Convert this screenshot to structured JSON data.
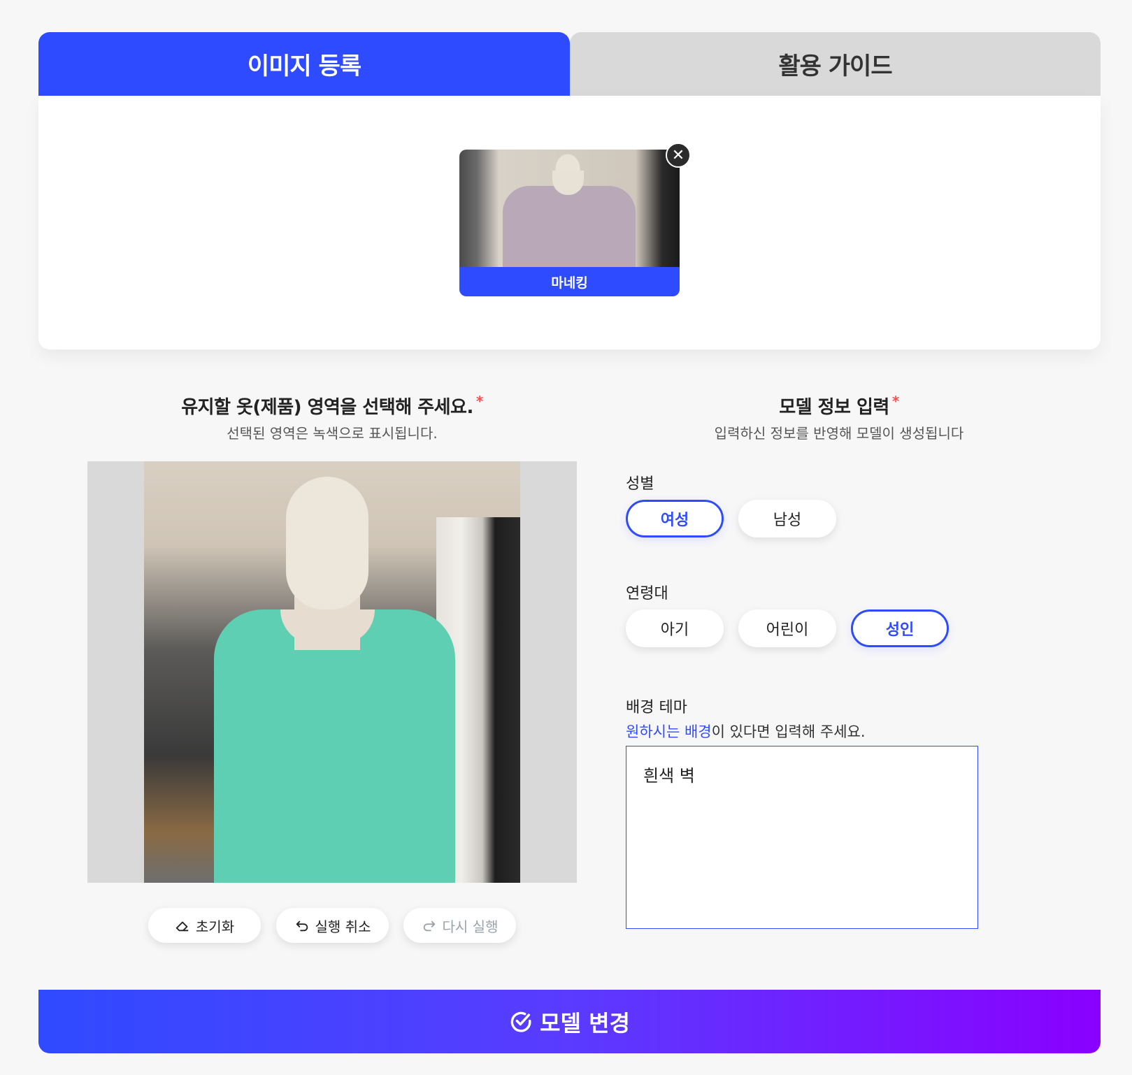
{
  "tabs": [
    {
      "label": "이미지 등록",
      "active": true
    },
    {
      "label": "활용 가이드",
      "active": false
    }
  ],
  "upload": {
    "thumbnail_label": "마네킹",
    "close_symbol": "✕"
  },
  "left_panel": {
    "title": "유지할 옷(제품) 영역을 선택해 주세요.",
    "required_mark": "*",
    "subtitle": "선택된 영역은 녹색으로 표시됩니다.",
    "tools": [
      {
        "label": "초기화",
        "icon": "eraser-icon",
        "enabled": true
      },
      {
        "label": "실행 취소",
        "icon": "undo-icon",
        "enabled": true
      },
      {
        "label": "다시 실행",
        "icon": "redo-icon",
        "enabled": false
      }
    ]
  },
  "right_panel": {
    "title": "모델 정보 입력",
    "required_mark": "*",
    "subtitle": "입력하신 정보를 반영해 모델이 생성됩니다",
    "gender": {
      "label": "성별",
      "options": [
        "여성",
        "남성"
      ],
      "selected": "여성"
    },
    "age": {
      "label": "연령대",
      "options": [
        "아기",
        "어린이",
        "성인"
      ],
      "selected": "성인"
    },
    "background": {
      "label": "배경 테마",
      "hint_accent": "원하시는 배경",
      "hint_rest": "이 있다면 입력해 주세요.",
      "value": "흰색 벽"
    }
  },
  "submit": {
    "label": "모델 변경",
    "icon": "check-circle-icon"
  },
  "colors": {
    "accent": "#2f4bff",
    "gradient_end": "#8a00ff",
    "required": "#ff4d4d",
    "tab_inactive": "#d9d9d9"
  }
}
